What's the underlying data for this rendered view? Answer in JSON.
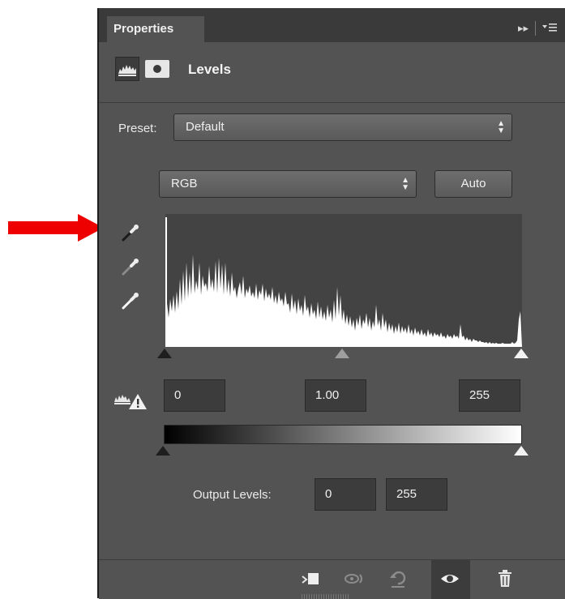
{
  "panel": {
    "tab_label": "Properties",
    "title": "Levels",
    "menu_glyph": "▸▸"
  },
  "preset": {
    "label": "Preset:",
    "value": "Default"
  },
  "channel": {
    "value": "RGB",
    "auto_label": "Auto"
  },
  "input_levels": {
    "black": "0",
    "gamma": "1.00",
    "white": "255"
  },
  "output_levels": {
    "label": "Output Levels:",
    "black": "0",
    "white": "255"
  },
  "icons": {
    "tab_menu": "flyout-menu-icon",
    "collapse": "double-arrow-icon",
    "adjustment": "levels-histogram-icon",
    "mask": "mask-icon",
    "black_eyedropper": "eyedropper-black-icon",
    "gray_eyedropper": "eyedropper-gray-icon",
    "white_eyedropper": "eyedropper-white-icon",
    "auto_warning": "warning-icon",
    "clip_to_layer": "clip-to-layer-icon",
    "view_previous": "view-previous-icon",
    "reset": "reset-icon",
    "visibility": "eye-icon",
    "delete": "trash-icon"
  },
  "colors": {
    "panel_bg": "#535353",
    "dark_bg": "#3a3a3a",
    "histogram_bg": "#434343",
    "arrow": "#ee0000"
  }
}
